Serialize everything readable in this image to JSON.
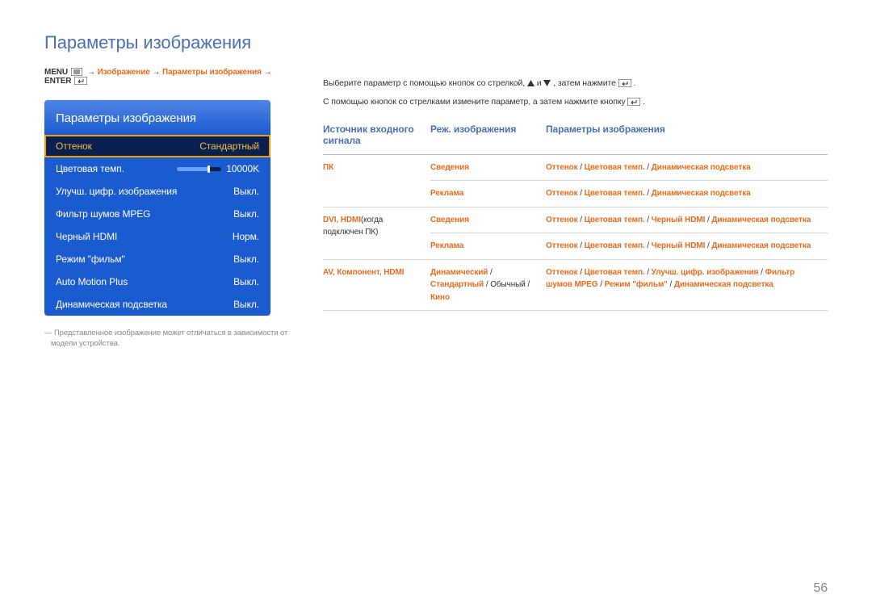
{
  "page_title": "Параметры изображения",
  "breadcrumb": {
    "prefix": "MENU",
    "path": [
      "Изображение",
      "Параметры изображения"
    ],
    "suffix": "ENTER"
  },
  "osd": {
    "title": "Параметры изображения",
    "rows": [
      {
        "label": "Оттенок",
        "value": "Стандартный",
        "highlight": true
      },
      {
        "label": "Цветовая темп.",
        "value": "10000K",
        "slider": true
      },
      {
        "label": "Улучш. цифр. изображения",
        "value": "Выкл."
      },
      {
        "label": "Фильтр шумов MPEG",
        "value": "Выкл."
      },
      {
        "label": "Черный HDMI",
        "value": "Норм."
      },
      {
        "label": "Режим \"фильм\"",
        "value": "Выкл."
      },
      {
        "label": "Auto Motion Plus",
        "value": "Выкл."
      },
      {
        "label": "Динамическая подсветка",
        "value": "Выкл."
      }
    ]
  },
  "footnote": "Представленное изображение может отличаться в зависимости от модели устройства.",
  "instructions": {
    "line1_a": "Выберите параметр с помощью кнопок со стрелкой, ",
    "line1_b": " и ",
    "line1_c": ", затем нажмите ",
    "line1_d": ".",
    "line2_a": "С помощью кнопок со стрелками измените параметр, а затем нажмите кнопку ",
    "line2_b": "."
  },
  "table": {
    "headers": [
      "Источник входного сигнала",
      "Реж. изображения",
      "Параметры изображения"
    ],
    "rows": [
      {
        "src_hl": "ПК",
        "src_plain": "",
        "modes": [
          {
            "hl": "Сведения"
          }
        ],
        "params": [
          "Оттенок",
          " / ",
          "Цветовая темп.",
          " / ",
          "Динамическая подсветка"
        ]
      },
      {
        "src_hl": "",
        "src_plain": "",
        "modes": [
          {
            "hl": "Реклама"
          }
        ],
        "params": [
          "Оттенок",
          " / ",
          "Цветовая темп.",
          " / ",
          "Динамическая подсветка"
        ]
      },
      {
        "src_hl": "DVI, HDMI",
        "src_plain": "(когда подключен ПК)",
        "modes": [
          {
            "hl": "Сведения"
          }
        ],
        "params": [
          "Оттенок",
          " / ",
          "Цветовая темп.",
          " / ",
          "Черный HDMI",
          " / ",
          "Динамическая подсветка"
        ]
      },
      {
        "src_hl": "",
        "src_plain": "",
        "modes": [
          {
            "hl": "Реклама"
          }
        ],
        "params": [
          "Оттенок",
          " / ",
          "Цветовая темп.",
          " / ",
          "Черный HDMI",
          " / ",
          "Динамическая подсветка"
        ]
      },
      {
        "src_hl": "AV, Компонент, HDMI",
        "src_plain": "",
        "modes": [
          {
            "hl": "Динамический"
          },
          {
            "sep": " / "
          },
          {
            "hl": "Стандартный"
          },
          {
            "sep": " / "
          },
          {
            "plain": "Обычный"
          },
          {
            "sep": " / "
          },
          {
            "hl": "Кино"
          }
        ],
        "params": [
          "Оттенок",
          " / ",
          "Цветовая темп.",
          " / ",
          "Улучш. цифр. изображения",
          " / ",
          "Фильтр шумов MPEG",
          " / ",
          "Режим \"фильм\"",
          " / ",
          "Динамическая подсветка"
        ]
      }
    ]
  },
  "page_number": "56"
}
